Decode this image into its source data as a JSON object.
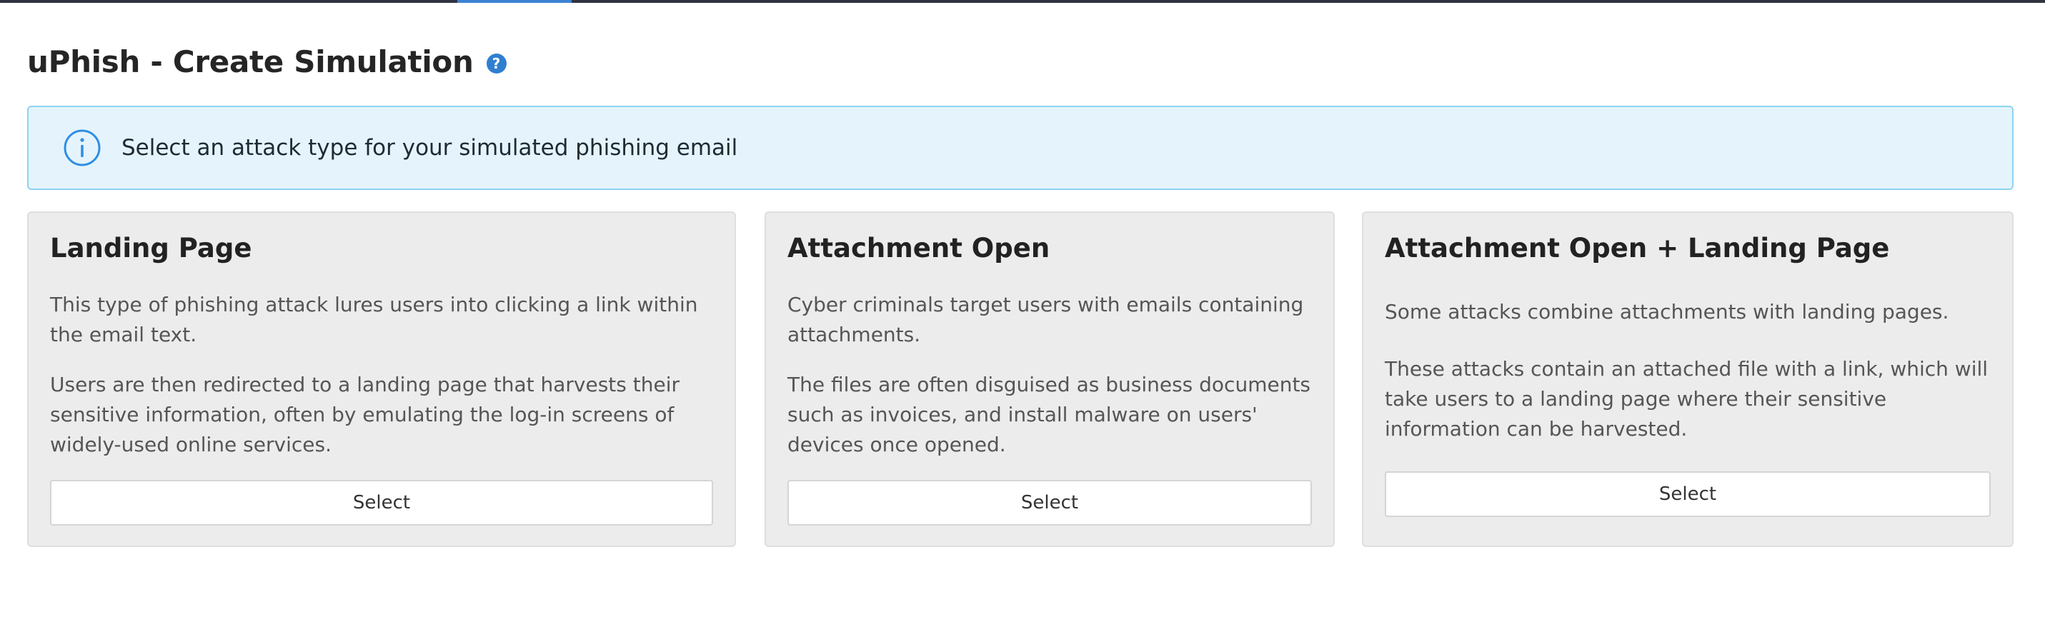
{
  "header": {
    "title": "uPhish - Create Simulation",
    "help_icon": "question-circle-icon",
    "help_glyph": "?"
  },
  "alert": {
    "icon": "info-circle-icon",
    "message": "Select an attack type for your simulated phishing email",
    "accent_color": "#2f8ee6",
    "background_color": "#e5f4fc"
  },
  "cards": [
    {
      "title": "Landing Page",
      "paragraphs": [
        "This type of phishing attack lures users into clicking a link within the email text.",
        "Users are then redirected to a landing page that harvests their sensitive information, often by emulating the log-in screens of widely-used online services."
      ],
      "button_label": "Select"
    },
    {
      "title": "Attachment Open",
      "paragraphs": [
        "Cyber criminals target users with emails containing attachments.",
        "The files are often disguised as business documents such as invoices, and install malware on users' devices once opened."
      ],
      "button_label": "Select"
    },
    {
      "title": "Attachment Open + Landing Page",
      "paragraphs": [
        "Some attacks combine attachments with landing pages.",
        "These attacks contain an attached file with a link, which will take users to a landing page where their sensitive information can be harvested."
      ],
      "button_label": "Select"
    }
  ]
}
